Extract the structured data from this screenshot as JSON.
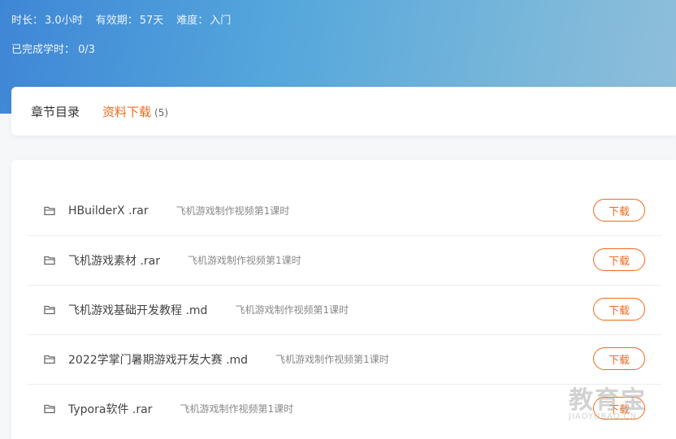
{
  "course": {
    "duration_label": "时长：",
    "duration_value": "3.0小时",
    "validity_label": "有效期：",
    "validity_value": "57天",
    "difficulty_label": "难度：",
    "difficulty_value": "入门",
    "progress_label": "已完成学时：",
    "progress_value": "0/3"
  },
  "tabs": [
    {
      "label": "章节目录",
      "active": false
    },
    {
      "label": "资料下载",
      "count": "(5)",
      "active": true
    }
  ],
  "accent_color": "#f06a1c",
  "files": [
    {
      "name": "HBuilderX .rar",
      "desc": "飞机游戏制作视频第1课时",
      "button": "下载"
    },
    {
      "name": "飞机游戏素材 .rar",
      "desc": "飞机游戏制作视频第1课时",
      "button": "下载"
    },
    {
      "name": "飞机游戏基础开发教程 .md",
      "desc": "飞机游戏制作视频第1课时",
      "button": "下载"
    },
    {
      "name": "2022学掌门暑期游戏开发大赛 .md",
      "desc": "飞机游戏制作视频第1课时",
      "button": "下载"
    },
    {
      "name": "Typora软件 .rar",
      "desc": "飞机游戏制作视频第1课时",
      "button": "下载"
    }
  ],
  "file_icon": "folder-icon",
  "watermark": {
    "main": "教育宝",
    "sub": "JIAOYUBAO.CN"
  }
}
